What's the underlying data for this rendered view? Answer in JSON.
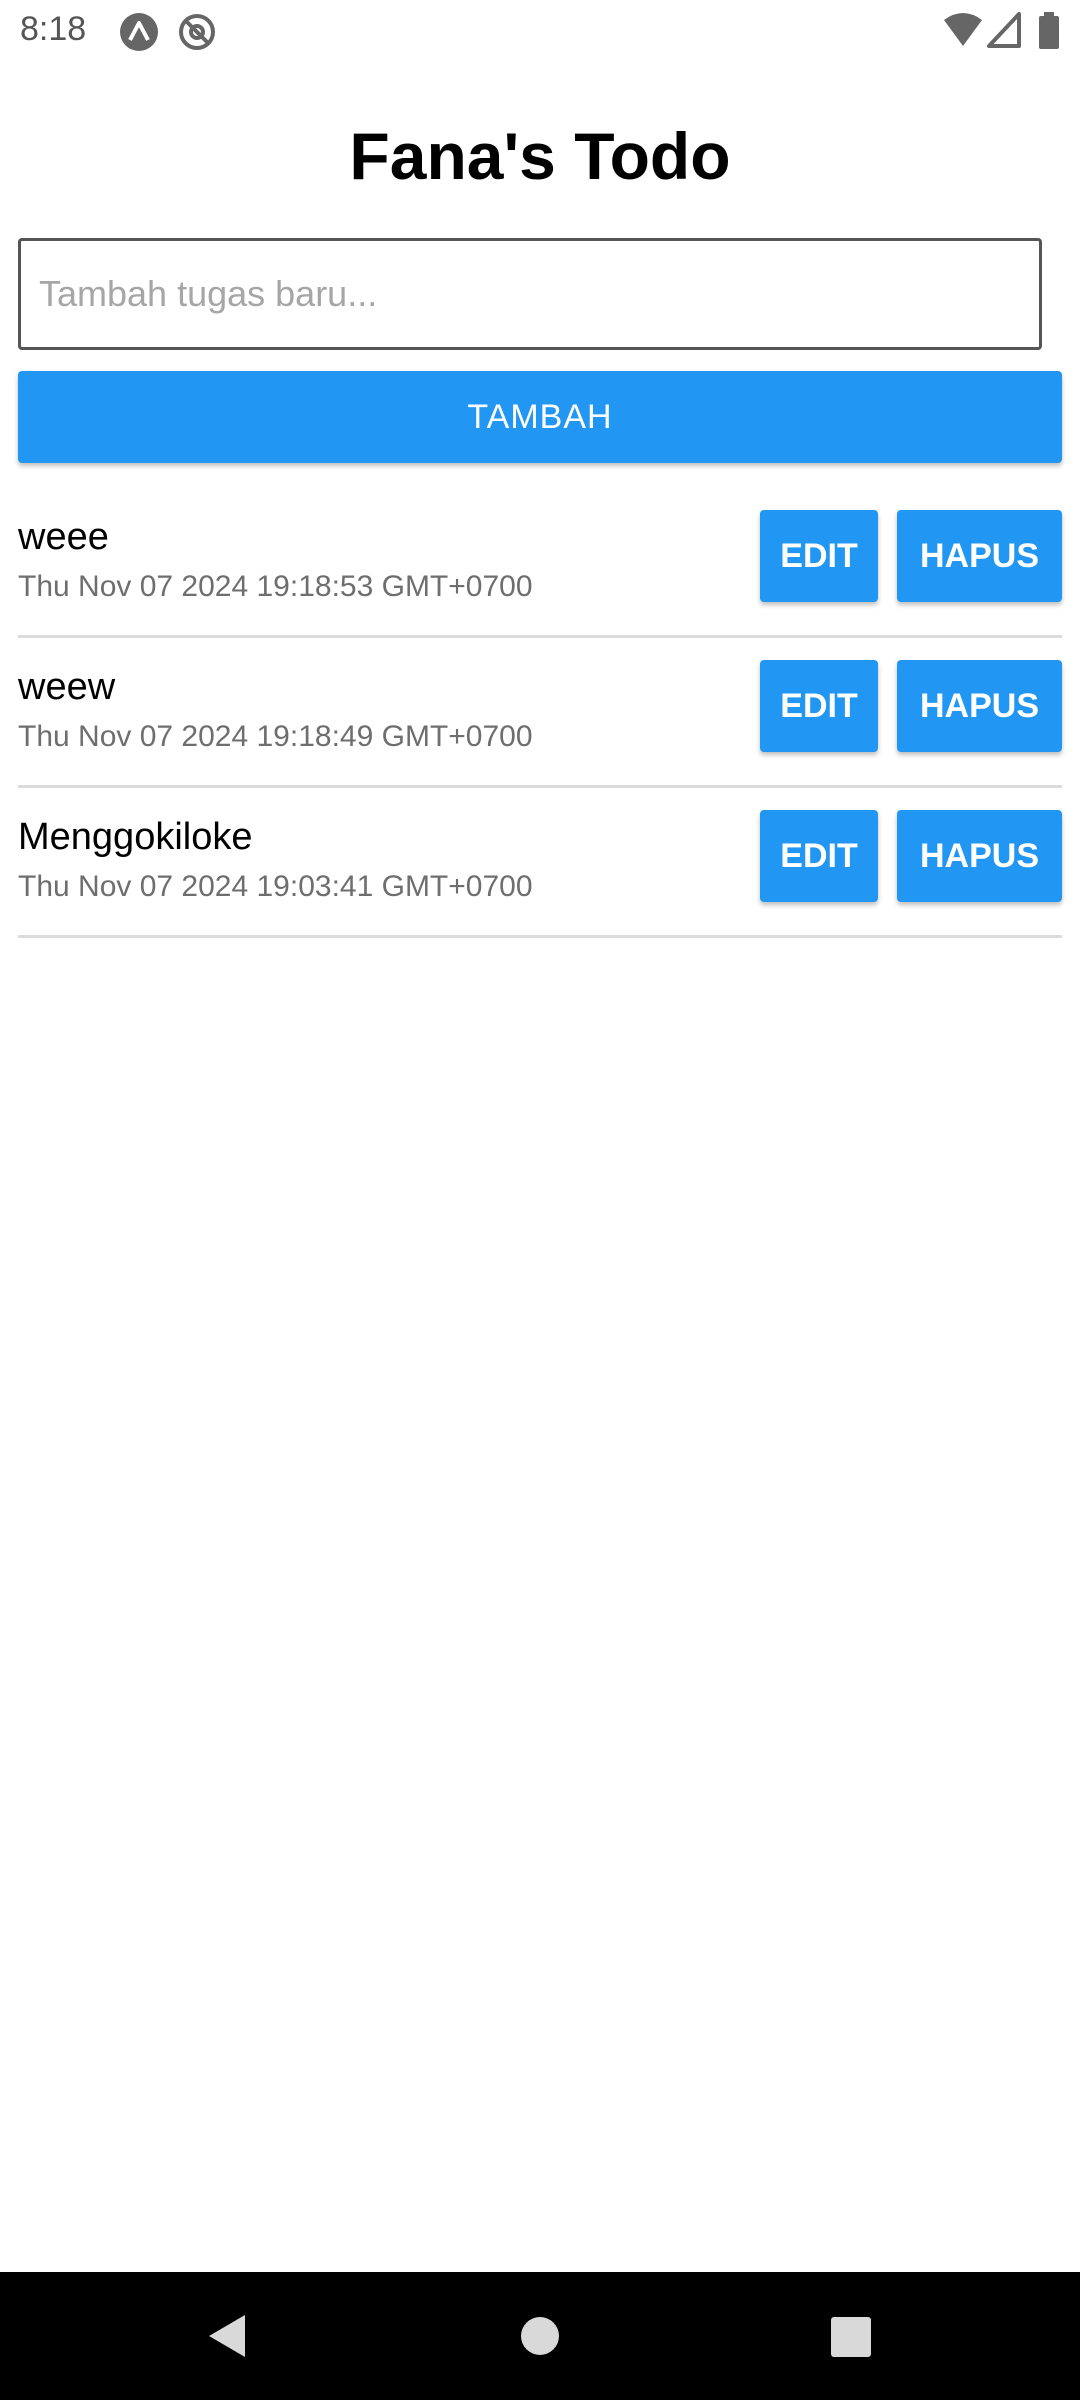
{
  "status_bar": {
    "time": "8:18",
    "icons": [
      "app-notification-icon",
      "at-sign-icon",
      "wifi-icon",
      "cell-signal-icon",
      "battery-icon"
    ]
  },
  "app": {
    "title": "Fana's Todo"
  },
  "input": {
    "value": "",
    "placeholder": "Tambah tugas baru..."
  },
  "add_button_label": "TAMBAH",
  "todos": [
    {
      "text": "weee",
      "date": "Thu Nov 07 2024 19:18:53 GMT+0700",
      "edit_label": "EDIT",
      "delete_label": "HAPUS"
    },
    {
      "text": "weew",
      "date": "Thu Nov 07 2024 19:18:49 GMT+0700",
      "edit_label": "EDIT",
      "delete_label": "HAPUS"
    },
    {
      "text": "Menggokiloke",
      "date": "Thu Nov 07 2024 19:03:41 GMT+0700",
      "edit_label": "EDIT",
      "delete_label": "HAPUS"
    }
  ],
  "colors": {
    "accent": "#2196F3",
    "divider": "#dcdcdc",
    "nav_bar": "#000000"
  },
  "nav_bar": {
    "icons": [
      "back-icon",
      "home-icon",
      "recents-icon"
    ]
  }
}
